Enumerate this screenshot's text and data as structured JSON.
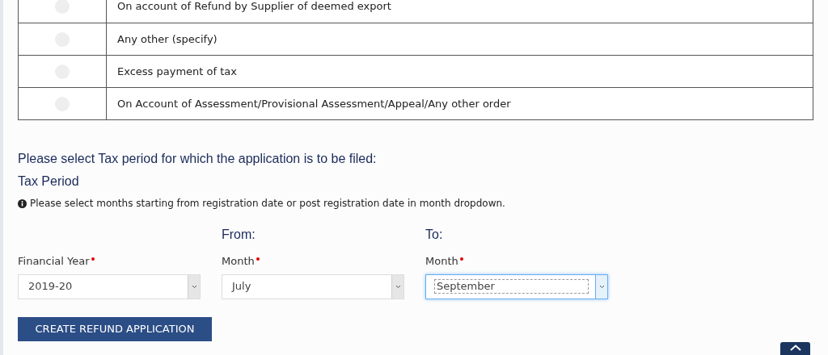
{
  "refund_reasons": [
    {
      "label": "On account of Refund by Supplier of deemed export",
      "selected": false
    },
    {
      "label": "Any other (specify)",
      "selected": false
    },
    {
      "label": "Excess payment of tax",
      "selected": false
    },
    {
      "label": "On Account of Assessment/Provisional Assessment/Appeal/Any other order",
      "selected": false
    }
  ],
  "prompt": "Please select Tax period for which the application is to be filed:",
  "section_title": "Tax Period",
  "info_note": "Please select months starting from registration date or post registration date in month dropdown.",
  "fields": [
    {
      "label": "Financial Year",
      "required": true,
      "value": "2019-20",
      "focused": false
    },
    {
      "group_label": "From:",
      "label": "Month",
      "required": true,
      "value": "July",
      "focused": false
    },
    {
      "group_label": "To:",
      "label": "Month",
      "required": true,
      "value": "September",
      "focused": true
    }
  ],
  "create_button": "CREATE REFUND APPLICATION"
}
